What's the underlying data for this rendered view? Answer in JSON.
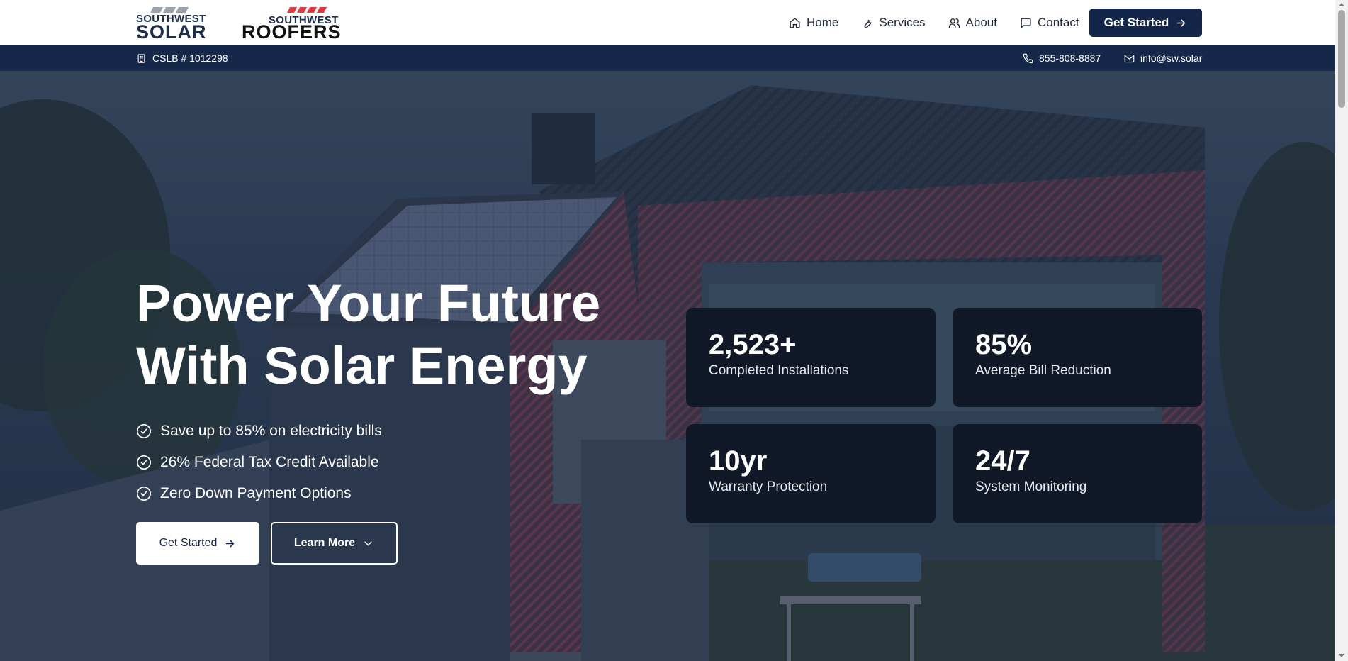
{
  "brand": {
    "solar_logo": {
      "top": "SOUTHWEST",
      "bottom": "SOLAR"
    },
    "roofers_logo": {
      "top": "SOUTHWEST",
      "bottom": "ROOFERS"
    }
  },
  "nav": {
    "items": [
      {
        "label": "Home",
        "icon": "home-icon"
      },
      {
        "label": "Services",
        "icon": "wrench-icon"
      },
      {
        "label": "About",
        "icon": "users-icon"
      },
      {
        "label": "Contact",
        "icon": "message-icon"
      }
    ],
    "cta_label": "Get Started"
  },
  "infobar": {
    "license": "CSLB # 1012298",
    "phone": "855-808-8887",
    "email": "info@sw.solar"
  },
  "hero": {
    "title_line1": "Power Your Future",
    "title_line2": "With Solar Energy",
    "benefits": [
      "Save up to 85% on electricity bills",
      "26% Federal Tax Credit Available",
      "Zero Down Payment Options"
    ],
    "primary_button": "Get Started",
    "secondary_button": "Learn More"
  },
  "stats": [
    {
      "value": "2,523+",
      "label": "Completed Installations"
    },
    {
      "value": "85%",
      "label": "Average Bill Reduction"
    },
    {
      "value": "10yr",
      "label": "Warranty Protection"
    },
    {
      "value": "24/7",
      "label": "System Monitoring"
    }
  ],
  "colors": {
    "navy": "#14254a",
    "infobar": "#15284a",
    "card": "#111827",
    "accent_red": "#e03a3e"
  }
}
